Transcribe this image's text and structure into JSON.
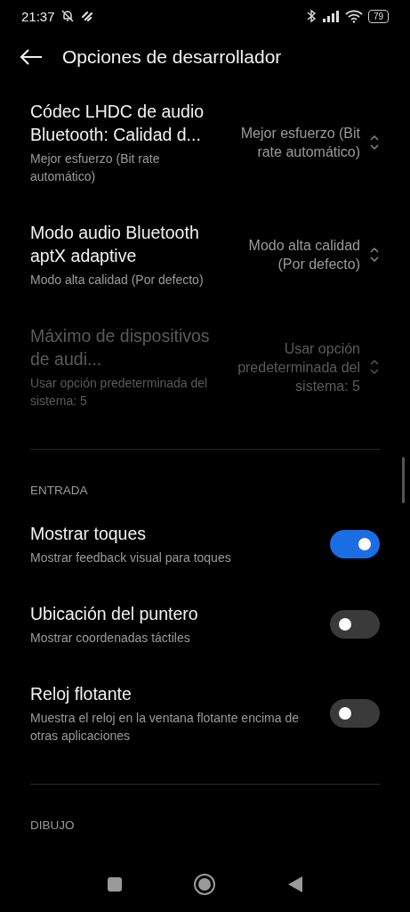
{
  "status_bar": {
    "time": "21:37",
    "battery": "79"
  },
  "header": {
    "title": "Opciones de desarrollador"
  },
  "groups": [
    {
      "items": [
        {
          "kind": "dropdown",
          "title": "Códec LHDC de audio Bluetooth: Calidad d...",
          "summary": "Mejor esfuerzo (Bit rate automático)",
          "value": "Mejor esfuerzo (Bit rate automático)",
          "disabled": false
        },
        {
          "kind": "dropdown",
          "title": "Modo audio Bluetooth aptX adaptive",
          "summary": "Modo alta calidad (Por defecto)",
          "value": "Modo alta calidad (Por defecto)",
          "disabled": false
        },
        {
          "kind": "dropdown",
          "title": "Máximo de dispositivos de audi...",
          "summary": "Usar opción predeterminada del sistema: 5",
          "value": "Usar opción predeterminada del sistema: 5",
          "disabled": true
        }
      ]
    },
    {
      "header": "ENTRADA",
      "items": [
        {
          "kind": "toggle",
          "title": "Mostrar toques",
          "summary": "Mostrar feedback visual para toques",
          "on": true
        },
        {
          "kind": "toggle",
          "title": "Ubicación del puntero",
          "summary": "Mostrar coordenadas táctiles",
          "on": false
        },
        {
          "kind": "toggle",
          "title": "Reloj flotante",
          "summary": "Muestra el reloj en la ventana flotante encima de otras aplicaciones",
          "on": false
        }
      ]
    },
    {
      "header": "DIBUJO"
    }
  ]
}
